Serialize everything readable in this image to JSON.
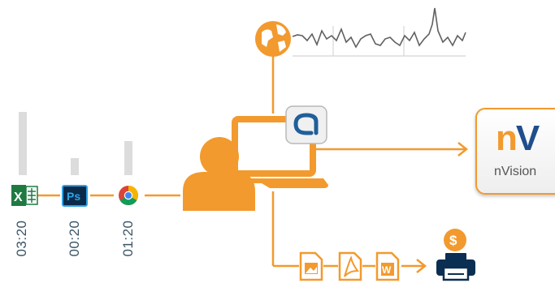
{
  "apps": [
    {
      "name": "Excel",
      "icon": "excel-icon",
      "time": "03:20",
      "usage_level": 1.0
    },
    {
      "name": "Photoshop",
      "icon": "photoshop-icon",
      "time": "00:20",
      "usage_level": 0.27
    },
    {
      "name": "Chrome",
      "icon": "chrome-icon",
      "time": "01:20",
      "usage_level": 0.54
    }
  ],
  "logo": {
    "mark_n": "n",
    "mark_v": "V",
    "name": "nVision"
  },
  "documents": [
    "image-file-icon",
    "pdf-file-icon",
    "word-file-icon"
  ],
  "colors": {
    "accent": "#f29a2e",
    "bar": "#dcdcdc",
    "text": "#3a5566",
    "brand_blue": "#1f4e8c"
  }
}
